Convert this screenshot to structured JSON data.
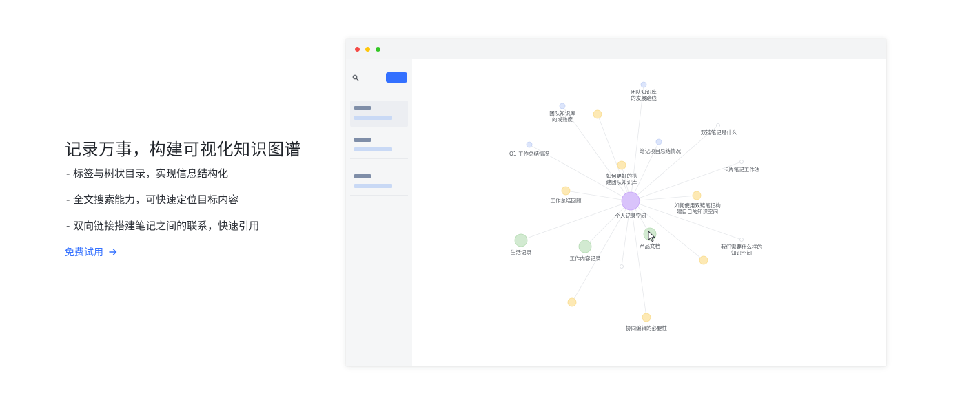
{
  "intro": {
    "title": "记录万事，构建可视化知识图谱",
    "features": [
      "- 标签与树状目录，实现信息结构化",
      "- 全文搜索能力，可快速定位目标内容",
      "- 双向链接搭建笔记之间的联系，快速引用"
    ],
    "cta": {
      "label": "免费试用",
      "icon": "arrow-right-icon"
    }
  },
  "colors": {
    "accent": "#3370ff",
    "node_center": "#d9c3fb",
    "node_green": "#d2ead1",
    "node_yellow": "#fde9b4",
    "node_blue": "#dce5fb",
    "edge": "#e6e8eb"
  },
  "graph": {
    "center": {
      "label": "个人记录空间"
    },
    "nodes": [
      {
        "type": "blue",
        "label": [
          "团队知识库",
          "的发展路线"
        ]
      },
      {
        "type": "blue",
        "label": [
          "团队知识库",
          "的成熟度"
        ]
      },
      {
        "type": "yellow",
        "label": []
      },
      {
        "type": "blue",
        "label": [
          "Q1 工作总结情况"
        ]
      },
      {
        "type": "blue",
        "label": [
          "笔记项目总结情况"
        ]
      },
      {
        "type": "faint",
        "label": [
          "双链笔记是什么"
        ]
      },
      {
        "type": "faint",
        "label": [
          "卡片笔记工作法"
        ]
      },
      {
        "type": "yellow",
        "label": [
          "如何更好的搭",
          "建团队知识库"
        ]
      },
      {
        "type": "yellow",
        "label": [
          "工作总结回顾"
        ]
      },
      {
        "type": "yellow",
        "label": [
          "如何使用双链笔记构",
          "建自己的知识空间"
        ]
      },
      {
        "type": "green",
        "label": [
          "生活记录"
        ]
      },
      {
        "type": "green",
        "label": [
          "工作内容记录"
        ]
      },
      {
        "type": "green",
        "label": [
          "产品文档"
        ]
      },
      {
        "type": "faint",
        "label": [
          "我们需要什么样的",
          "知识空间"
        ]
      },
      {
        "type": "yellow",
        "label": []
      },
      {
        "type": "faint",
        "label": []
      },
      {
        "type": "yellow",
        "label": []
      },
      {
        "type": "yellow",
        "label": [
          "协同编辑的必要性"
        ]
      }
    ]
  },
  "window": {
    "sidebar": {
      "search_icon": "search-icon",
      "items": [
        {
          "active": true
        },
        {
          "active": false
        },
        {
          "active": false
        }
      ]
    }
  }
}
